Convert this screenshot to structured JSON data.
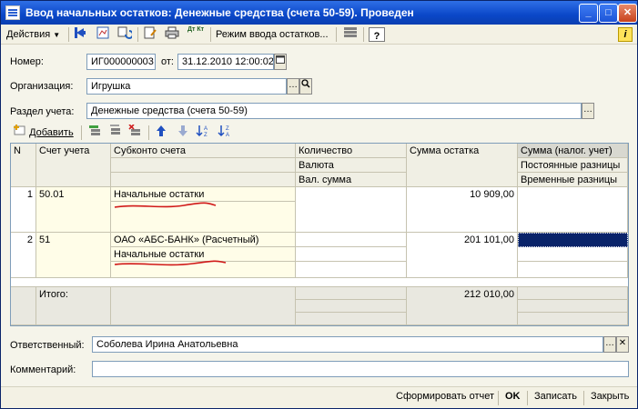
{
  "window": {
    "title": "Ввод начальных остатков: Денежные средства (счета 50-59). Проведен",
    "buttons": {
      "minimize": "_",
      "maximize": "□",
      "close": "✕"
    }
  },
  "toolbar": {
    "actions_label": "Действия",
    "mode_label": "Режим ввода остатков...",
    "help_label": "?",
    "info_label": "i",
    "dt_kt_label": "Дт Кт"
  },
  "form": {
    "number_label": "Номер:",
    "number_value": "ИГ000000003",
    "date_label": "от:",
    "date_value": "31.12.2010 12:00:02",
    "org_label": "Организация:",
    "org_value": "Игрушка",
    "section_label": "Раздел учета:",
    "section_value": "Денежные средства (счета 50-59)",
    "responsible_label": "Ответственный:",
    "responsible_value": "Соболева Ирина Анатольевна",
    "comment_label": "Комментарий:",
    "comment_value": ""
  },
  "table_toolbar": {
    "add_label": "Добавить"
  },
  "table": {
    "headers": {
      "n": "N",
      "account": "Счет учета",
      "subconto": "Субконто счета",
      "quantity": "Количество",
      "currency": "Валюта",
      "currency_sum": "Вал. сумма",
      "balance": "Сумма остатка",
      "tax_sum": "Сумма (налог. учет)",
      "const_diff": "Постоянные разницы",
      "temp_diff": "Временные разницы"
    },
    "rows": [
      {
        "n": "1",
        "account": "50.01",
        "subconto1": "Начальные остатки",
        "subconto2": "",
        "balance": "10 909,00"
      },
      {
        "n": "2",
        "account": "51",
        "subconto1": "ОАО «АБС-БАНК» (Расчетный)",
        "subconto2": "Начальные остатки",
        "balance": "201 101,00"
      }
    ],
    "footer": {
      "label": "Итого:",
      "total": "212 010,00"
    }
  },
  "bottom": {
    "report_label": "Сформировать отчет",
    "ok_label": "OK",
    "save_label": "Записать",
    "close_label": "Закрыть"
  },
  "colors": {
    "title_bar": "#0a47c8",
    "annotation_stroke": "#d01818",
    "selection": "#0a246a"
  }
}
